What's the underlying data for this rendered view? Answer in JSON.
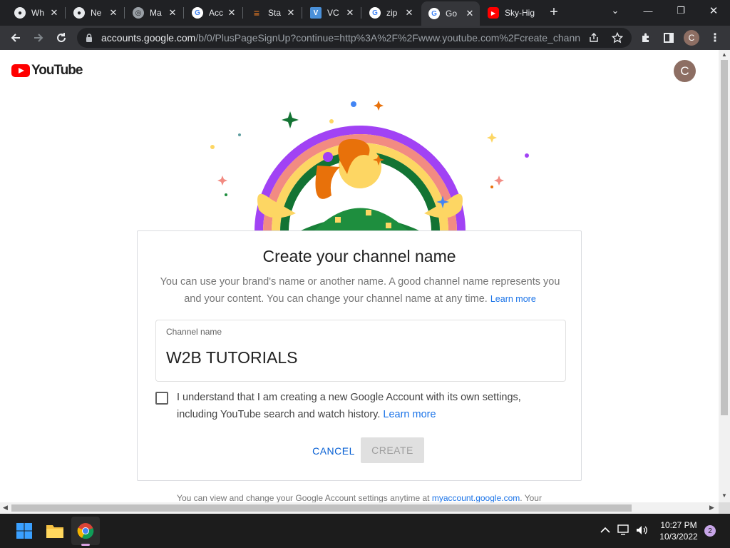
{
  "browser": {
    "tabs": [
      {
        "title": "Wh",
        "favicon": "github-icon",
        "active": false
      },
      {
        "title": "Ne",
        "favicon": "github-icon",
        "active": false
      },
      {
        "title": "Ma",
        "favicon": "globe-icon",
        "active": false
      },
      {
        "title": "Acc",
        "favicon": "google-icon",
        "active": false
      },
      {
        "title": "Sta",
        "favicon": "stackoverflow-icon",
        "active": false
      },
      {
        "title": "VC",
        "favicon": "v-icon",
        "active": false
      },
      {
        "title": "zip",
        "favicon": "google-icon",
        "active": false
      },
      {
        "title": "Go",
        "favicon": "google-icon",
        "active": true
      },
      {
        "title": "Sky-Hig",
        "favicon": "youtube-icon",
        "active": false
      }
    ],
    "url_host": "accounts.google.com",
    "url_path": "/b/0/PlusPageSignUp?continue=http%3A%2F%2Fwww.youtube.com%2Fcreate_chann...",
    "profile_initial": "C"
  },
  "page": {
    "logo_text": "YouTube",
    "account_initial": "C",
    "card": {
      "title": "Create your channel name",
      "description": "You can use your brand's name or another name. A good channel name represents you and your content. You can change your channel name at any time.",
      "learn_more": "Learn more",
      "field_label": "Channel name",
      "field_value": "W2B TUTORIALS",
      "checkbox_text": "I understand that I am creating a new Google Account with its own settings, including YouTube search and watch history.",
      "checkbox_learn_more": "Learn more",
      "checked": false,
      "cancel_label": "CANCEL",
      "create_label": "CREATE"
    },
    "footer_prefix": "You can view and change your Google Account settings anytime at",
    "footer_link": "myaccount.google.com",
    "footer_suffix": ". Your"
  },
  "taskbar": {
    "time": "10:27 PM",
    "date": "10/3/2022",
    "notifications": "2"
  },
  "colors": {
    "youtube_red": "#ff0000",
    "link_blue": "#1a73e8",
    "button_blue": "#065fd4"
  }
}
